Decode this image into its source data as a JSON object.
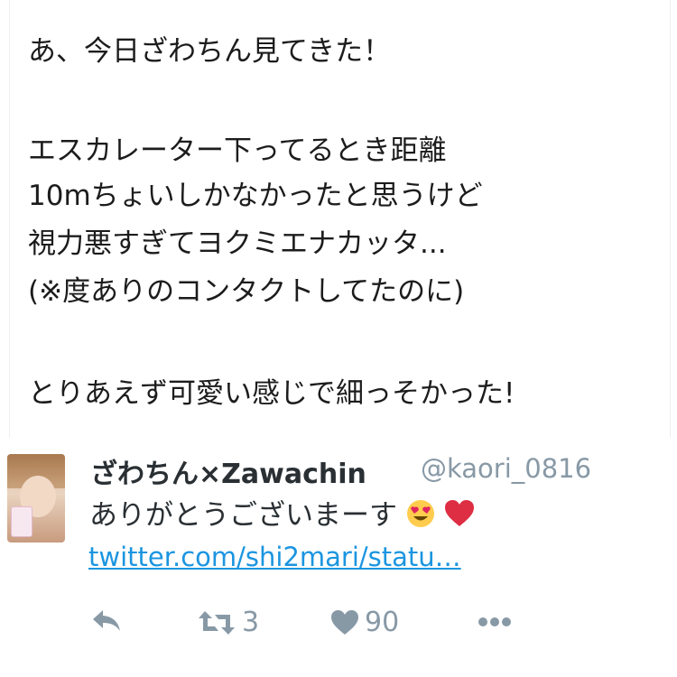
{
  "quoted_tweet": {
    "lines": [
      "あ、今日ざわちん見てきた！",
      "",
      "エスカレーター下ってるとき距離",
      "10mちょいしかなかったと思うけど",
      "視力悪すぎてヨクミエナカッタ...",
      "(※度ありのコンタクトしてたのに)",
      "",
      "とりあえず可愛い感じで細っそかった!"
    ]
  },
  "reply_tweet": {
    "display_name": "ざわちん×Zawachin",
    "handle": "@kaori_0816",
    "text": "ありがとうございまーす",
    "emoji": [
      "heart-eyes-face-icon",
      "red-heart-icon"
    ],
    "link": "twitter.com/shi2mari/statu…",
    "actions": {
      "reply_icon": "reply-arrow-icon",
      "retweet_icon": "retweet-icon",
      "retweet_count": "3",
      "like_icon": "heart-icon",
      "like_count": "90",
      "more_icon": "more-dots-icon"
    }
  },
  "colors": {
    "text": "#292f33",
    "muted": "#8899a6",
    "link": "#1b95e0"
  }
}
